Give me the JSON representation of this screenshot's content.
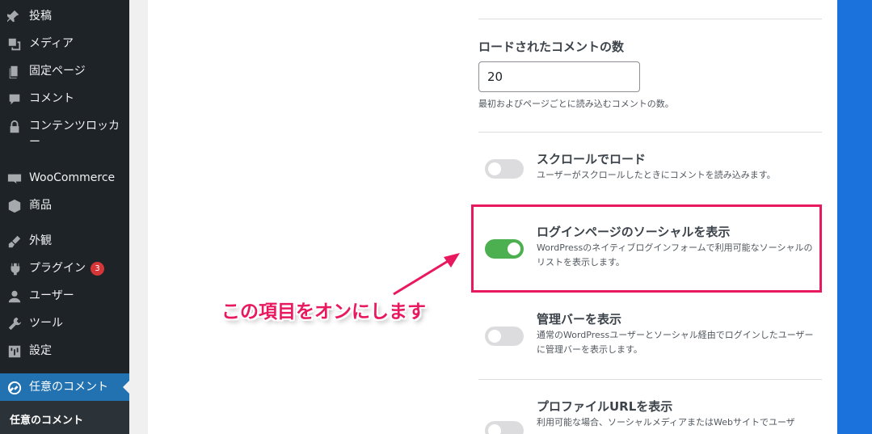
{
  "sidebar": {
    "items": [
      {
        "label": "投稿",
        "icon": "pin-icon"
      },
      {
        "label": "メディア",
        "icon": "media-icon"
      },
      {
        "label": "固定ページ",
        "icon": "pages-icon"
      },
      {
        "label": "コメント",
        "icon": "comments-icon"
      },
      {
        "label": "コンテンツロッカー",
        "icon": "lock-icon"
      },
      {
        "label": "WooCommerce",
        "icon": "woo-icon"
      },
      {
        "label": "商品",
        "icon": "box-icon"
      },
      {
        "label": "外観",
        "icon": "brush-icon"
      },
      {
        "label": "プラグイン",
        "icon": "plugin-icon",
        "badge": "3"
      },
      {
        "label": "ユーザー",
        "icon": "user-icon"
      },
      {
        "label": "ツール",
        "icon": "wrench-icon"
      },
      {
        "label": "設定",
        "icon": "settings-icon"
      }
    ],
    "current": {
      "label": "任意のコメント",
      "icon": "wpdiscuz-icon"
    },
    "submenu_label": "任意のコメント"
  },
  "settings": {
    "loaded_comments": {
      "label": "ロードされたコメントの数",
      "value": "20",
      "description": "最初およびページごとに読み込むコメントの数。"
    },
    "scroll_load": {
      "label": "スクロールでロード",
      "description": "ユーザーがスクロールしたときにコメントを読み込みます。",
      "enabled": false
    },
    "social_login": {
      "label": "ログインページのソーシャルを表示",
      "description": "WordPressのネイティブログインフォームで利用可能なソーシャルのリストを表示します。",
      "enabled": true
    },
    "admin_bar": {
      "label": "管理バーを表示",
      "description": "通常のWordPressユーザーとソーシャル経由でログインしたユーザーに管理バーを表示します。",
      "enabled": false
    },
    "profile_url": {
      "label": "プロファイルURLを表示",
      "description": "利用可能な場合、ソーシャルメディアまたはWebサイトでユーザ",
      "enabled": false
    }
  },
  "annotation": {
    "callout_text": "この項目をオンにします",
    "accent_color": "#e8195f"
  },
  "colors": {
    "sidebar_bg": "#1d2327",
    "menu_active": "#2271b1",
    "toggle_on": "#4caf50",
    "right_bar": "#1b72dd"
  }
}
